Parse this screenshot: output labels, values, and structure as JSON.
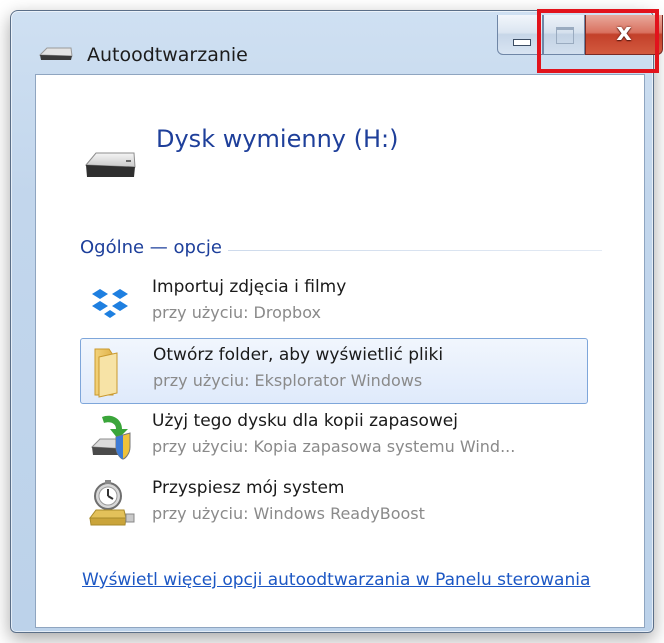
{
  "window": {
    "title": "Autoodtwarzanie",
    "close_glyph": "x",
    "close_highlight_color": "#e2131c"
  },
  "device": {
    "name": "Dysk wymienny (H:)",
    "icon": "removable-drive-icon"
  },
  "section": {
    "header": "Ogólne — opcje"
  },
  "options": [
    {
      "title": "Importuj zdjęcia i filmy",
      "subtitle": "przy użyciu: Dropbox",
      "icon": "dropbox-icon",
      "selected": false
    },
    {
      "title": "Otwórz folder, aby wyświetlić pliki",
      "subtitle": "przy użyciu: Eksplorator Windows",
      "icon": "folder-icon",
      "selected": true
    },
    {
      "title": "Użyj tego dysku dla kopii zapasowej",
      "subtitle": "przy użyciu: Kopia zapasowa systemu Wind...",
      "icon": "backup-icon",
      "selected": false
    },
    {
      "title": "Przyspiesz mój system",
      "subtitle": "przy użyciu: Windows ReadyBoost",
      "icon": "readyboost-icon",
      "selected": false
    }
  ],
  "footer": {
    "link": "Wyświetl więcej opcji autoodtwarzania w Panelu sterowania"
  }
}
